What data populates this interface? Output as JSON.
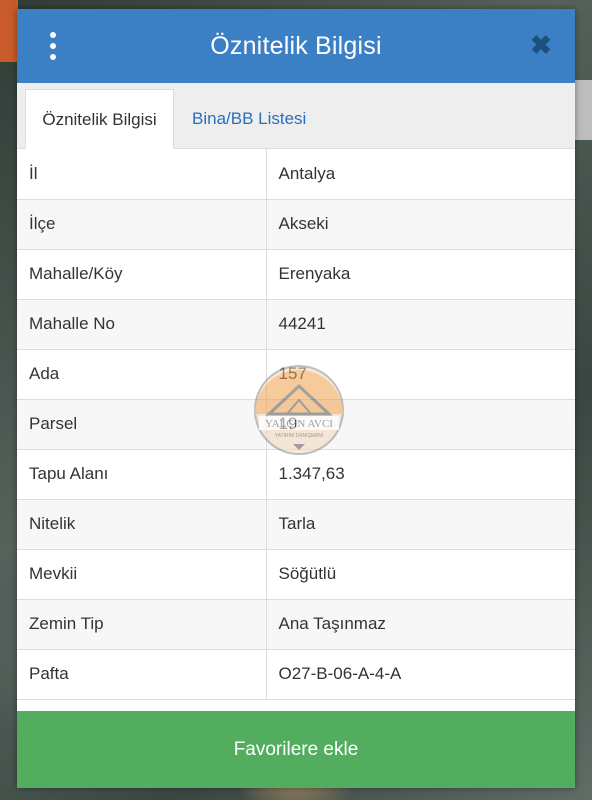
{
  "header": {
    "title": "Öznitelik Bilgisi"
  },
  "tabs": [
    {
      "label": "Öznitelik Bilgisi",
      "active": true
    },
    {
      "label": "Bina/BB Listesi",
      "active": false
    }
  ],
  "attributes": [
    {
      "key": "İl",
      "value": "Antalya"
    },
    {
      "key": "İlçe",
      "value": "Akseki"
    },
    {
      "key": "Mahalle/Köy",
      "value": "Erenyaka"
    },
    {
      "key": "Mahalle No",
      "value": "44241"
    },
    {
      "key": "Ada",
      "value": "157"
    },
    {
      "key": "Parsel",
      "value": "19"
    },
    {
      "key": "Tapu Alanı",
      "value": "1.347,63"
    },
    {
      "key": "Nitelik",
      "value": "Tarla"
    },
    {
      "key": "Mevkii",
      "value": "Söğütlü"
    },
    {
      "key": "Zemin Tip",
      "value": "Ana Taşınmaz"
    },
    {
      "key": "Pafta",
      "value": "O27-B-06-A-4-A"
    }
  ],
  "footer": {
    "button_label": "Favorilere ekle"
  },
  "watermark": {
    "name": "YALÇIN AVCI",
    "subtitle": "YATIRIM DANIŞMANI"
  },
  "icons": {
    "menu": "vertical-dots-icon",
    "close": "close-icon"
  },
  "colors": {
    "header": "#3b7fc4",
    "footer_button": "#52ad5f",
    "tab_link": "#2a6ebb"
  }
}
